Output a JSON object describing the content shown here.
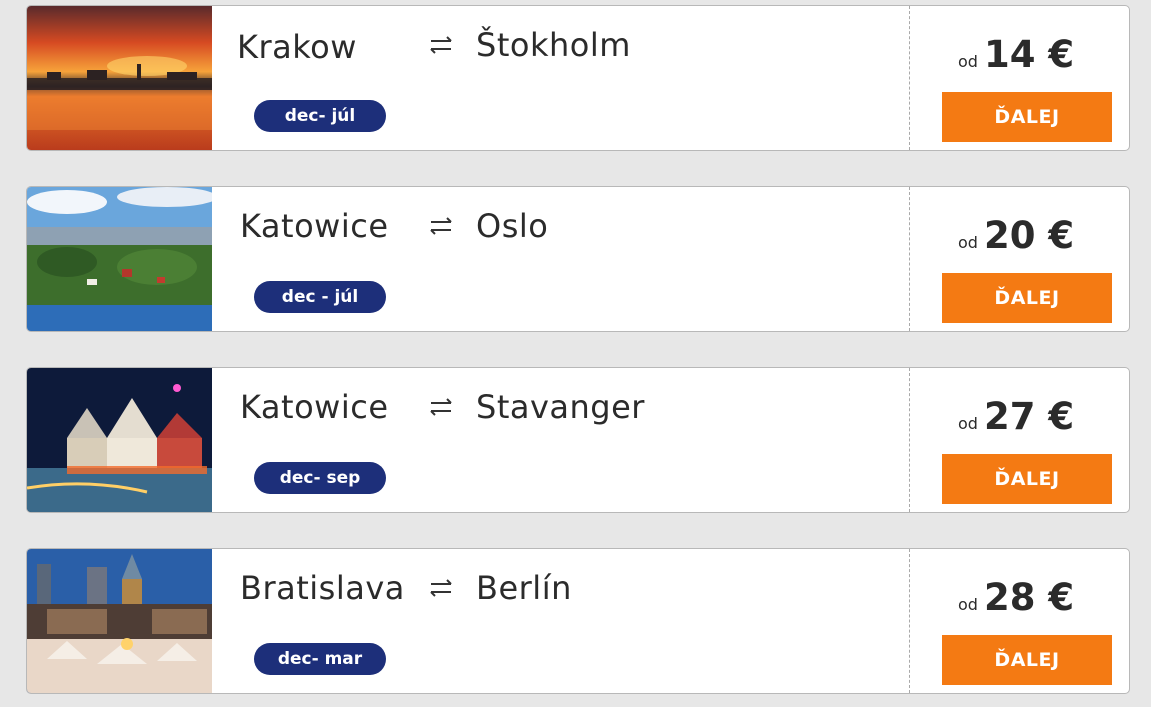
{
  "routes": [
    {
      "from": "Krakow",
      "to": "Štokholm",
      "dates": "dec- júl",
      "price_prefix": "od",
      "price": "14 €",
      "cta": "ĎALEJ",
      "image": "stockholm-sunset-photo"
    },
    {
      "from": "Katowice",
      "to": "Oslo",
      "dates": "dec - júl",
      "price_prefix": "od",
      "price": "20 €",
      "cta": "ĎALEJ",
      "image": "oslo-coast-photo"
    },
    {
      "from": "Katowice",
      "to": "Stavanger",
      "dates": "dec- sep",
      "price_prefix": "od",
      "price": "27 €",
      "cta": "ĎALEJ",
      "image": "stavanger-night-photo"
    },
    {
      "from": "Bratislava",
      "to": "Berlín",
      "dates": "dec- mar",
      "price_prefix": "od",
      "price": "28 €",
      "cta": "ĎALEJ",
      "image": "berlin-christmas-market-photo"
    }
  ],
  "icons": {
    "swap": "swap-arrows-icon"
  },
  "colors": {
    "badge": "#1d2f7a",
    "button": "#f47a13",
    "background": "#e7e7e7"
  }
}
